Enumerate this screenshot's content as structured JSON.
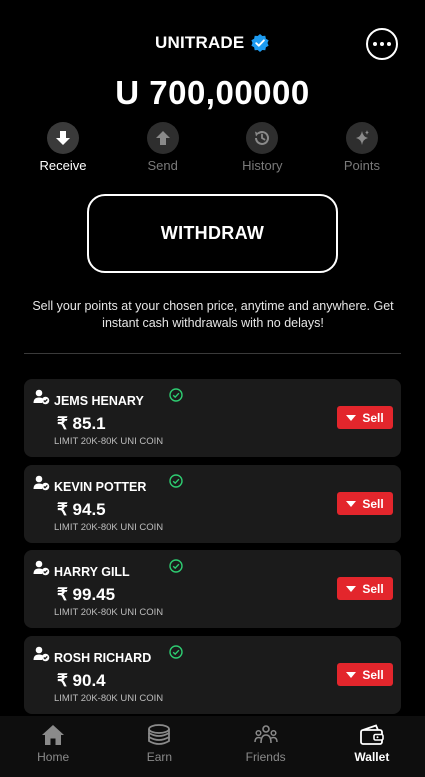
{
  "header": {
    "brand": "UNITRADE"
  },
  "balance": "U 700,00000",
  "actions": [
    {
      "label": "Receive",
      "icon": "arrow-down-icon",
      "active": true
    },
    {
      "label": "Send",
      "icon": "arrow-up-icon",
      "active": false
    },
    {
      "label": "History",
      "icon": "history-icon",
      "active": false
    },
    {
      "label": "Points",
      "icon": "sparkle-icon",
      "active": false
    }
  ],
  "withdraw_label": "WITHDRAW",
  "info_text": "Sell your points at your chosen price, anytime and anywhere. Get instant cash withdrawals with no delays!",
  "offers": [
    {
      "name": "JEMS HENARY",
      "price": "₹ 85.1",
      "limit": "LIMIT 20K-80K UNI COIN",
      "sell_label": "Sell"
    },
    {
      "name": "KEVIN POTTER",
      "price": "₹ 94.5",
      "limit": "LIMIT 20K-80K UNI COIN",
      "sell_label": "Sell"
    },
    {
      "name": "HARRY GILL",
      "price": "₹ 99.45",
      "limit": "LIMIT 20K-80K UNI COIN",
      "sell_label": "Sell"
    },
    {
      "name": "ROSH RICHARD",
      "price": "₹ 90.4",
      "limit": "LIMIT 20K-80K UNI COIN",
      "sell_label": "Sell"
    }
  ],
  "nav": [
    {
      "label": "Home",
      "icon": "home-icon",
      "active": false
    },
    {
      "label": "Earn",
      "icon": "coins-icon",
      "active": false
    },
    {
      "label": "Friends",
      "icon": "friends-icon",
      "active": false
    },
    {
      "label": "Wallet",
      "icon": "wallet-icon",
      "active": true
    }
  ],
  "colors": {
    "accent_sell": "#e3262c",
    "verified_blue": "#1d9bf0",
    "check_green": "#2ecc71",
    "card_bg": "#1b1b1b"
  }
}
